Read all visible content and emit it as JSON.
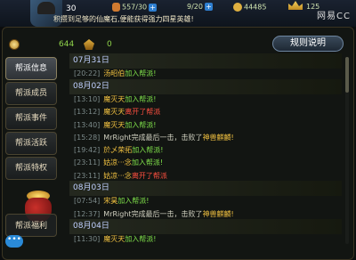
{
  "topbar": {
    "level": "30",
    "stamina": "557/30",
    "energy": "9/20",
    "gold": "44485",
    "ingot": "125",
    "marquee": "积攒到足够的仙魔石,便能获得强力四星英雄!",
    "watermark": "网易CC"
  },
  "resources": {
    "contribution": "644",
    "fund": "0"
  },
  "help_label": "规则说明",
  "sidebar": {
    "items": [
      {
        "label": "帮派信息",
        "active": true
      },
      {
        "label": "帮派成员",
        "active": false
      },
      {
        "label": "帮派事件",
        "active": false
      },
      {
        "label": "帮派活跃",
        "active": false
      },
      {
        "label": "帮派特权",
        "active": false
      }
    ],
    "welfare": "帮派福利",
    "chat": "•••"
  },
  "log": [
    {
      "type": "date",
      "text": "07月31日"
    },
    {
      "type": "event",
      "time": "[20:22]",
      "name": "汤昭伯",
      "action": "加入帮派!",
      "kind": "join"
    },
    {
      "type": "date",
      "text": "08月02日"
    },
    {
      "type": "event",
      "time": "[13:10]",
      "name": "魔灭天",
      "action": "加入帮派!",
      "kind": "join"
    },
    {
      "type": "event",
      "time": "[13:12]",
      "name": "魔灭天",
      "action": "离开了帮派",
      "kind": "leave"
    },
    {
      "type": "event",
      "time": "[13:40]",
      "name": "魔灭天",
      "action": "加入帮派!",
      "kind": "join"
    },
    {
      "type": "event",
      "time": "[15:28]",
      "name": "MrRight",
      "action": "完成最后一击，击败了",
      "beast": "神兽麒麟!",
      "kind": "kill"
    },
    {
      "type": "event",
      "time": "[19:42]",
      "name": "於乄荣拓",
      "action": "加入帮派!",
      "kind": "join"
    },
    {
      "type": "event",
      "time": "[23:11]",
      "name": "姑凉···念",
      "action": "加入帮派!",
      "kind": "join"
    },
    {
      "type": "event",
      "time": "[23:11]",
      "name": "姑凉···念",
      "action": "离开了帮派",
      "kind": "leave"
    },
    {
      "type": "date",
      "text": "08月03日"
    },
    {
      "type": "event",
      "time": "[07:54]",
      "name": "宋昊",
      "action": "加入帮派!",
      "kind": "join"
    },
    {
      "type": "event",
      "time": "[12:37]",
      "name": "MrRight",
      "action": "完成最后一击，击败了",
      "beast": "神兽麒麟!",
      "kind": "kill"
    },
    {
      "type": "date",
      "text": "08月04日"
    },
    {
      "type": "event",
      "time": "[11:30]",
      "name": "魔灭天",
      "action": "加入帮派!",
      "kind": "join"
    }
  ],
  "colors": {
    "join": "#7fe04a",
    "leave": "#ff5040",
    "name": "#f0c040"
  }
}
